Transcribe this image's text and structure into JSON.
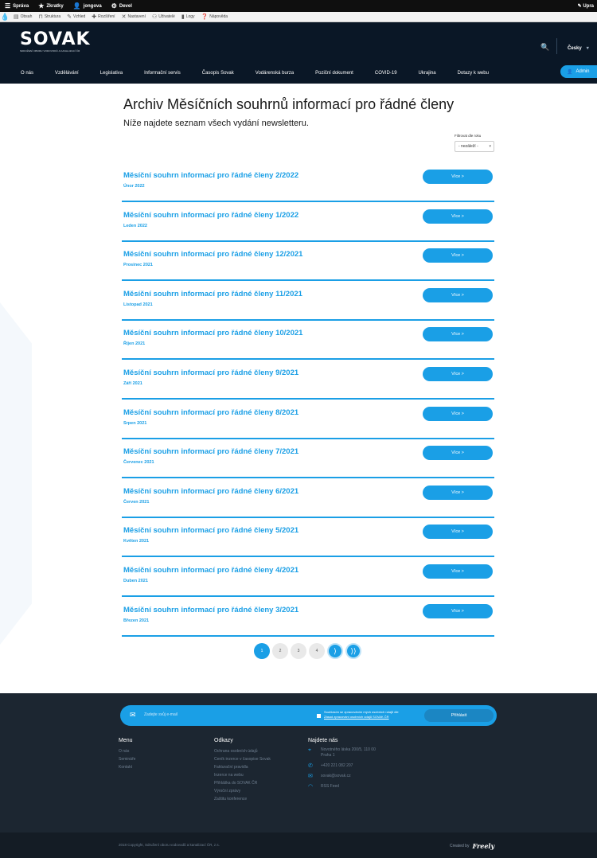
{
  "admin_bar": {
    "items": [
      {
        "icon": "menu-icon",
        "glyph": "☰",
        "label": "Správa"
      },
      {
        "icon": "star-icon",
        "glyph": "★",
        "label": "Zkratky"
      },
      {
        "icon": "user-icon",
        "glyph": "👤",
        "label": "jongova"
      },
      {
        "icon": "gear-icon",
        "glyph": "⚙",
        "label": "Devel"
      }
    ],
    "right_label": "Upra"
  },
  "admin_tray": {
    "items": [
      {
        "icon": "file-icon",
        "glyph": "▤",
        "label": "Obsah"
      },
      {
        "icon": "structure-icon",
        "glyph": "⊓",
        "label": "Struktura"
      },
      {
        "icon": "brush-icon",
        "glyph": "✎",
        "label": "Vzhled"
      },
      {
        "icon": "puzzle-icon",
        "glyph": "✚",
        "label": "Rozšíření"
      },
      {
        "icon": "wrench-icon",
        "glyph": "✕",
        "label": "Nastavení"
      },
      {
        "icon": "people-icon",
        "glyph": "⚇",
        "label": "Uživatelé"
      },
      {
        "icon": "bars-icon",
        "glyph": "▮",
        "label": "Logy"
      },
      {
        "icon": "help-icon",
        "glyph": "❓",
        "label": "Nápověda"
      }
    ]
  },
  "header": {
    "logo_text": "SOVAK",
    "logo_sub": "SDRUŽENÍ OBORU VODOVODŮ A KANALIZACÍ ČR",
    "language": "Česky",
    "nav": [
      "O nás",
      "Vzdělávání",
      "Legislativa",
      "Informační servis",
      "Časopis Sovak",
      "Vodárenská burza",
      "Poziční dokument",
      "COVID-19",
      "Ukrajina",
      "Dotazy k webu"
    ],
    "admin_label": "Admin"
  },
  "main": {
    "title": "Archiv Měsíčních souhrnů informací pro řádné členy",
    "subtitle": "Níže najdete seznam všech vydání newsletteru.",
    "filter_label": "Filtrovat dle roku",
    "filter_value": "- nezáleží -",
    "button_label": "Více >",
    "items": [
      {
        "title": "Měsíční souhrn informací pro řádné členy 2/2022",
        "date": "Únor 2022"
      },
      {
        "title": "Měsíční souhrn informací pro řádné členy 1/2022",
        "date": "Leden 2022"
      },
      {
        "title": "Měsíční souhrn informací pro řádné členy 12/2021",
        "date": "Prosinec 2021"
      },
      {
        "title": "Měsíční souhrn informací pro řádné členy 11/2021",
        "date": "Listopad 2021"
      },
      {
        "title": "Měsíční souhrn informací pro řádné členy 10/2021",
        "date": "Říjen 2021"
      },
      {
        "title": "Měsíční souhrn informací pro řádné členy 9/2021",
        "date": "Září 2021"
      },
      {
        "title": "Měsíční souhrn informací pro řádné členy 8/2021",
        "date": "Srpen 2021"
      },
      {
        "title": "Měsíční souhrn informací pro řádné členy 7/2021",
        "date": "Červenec 2021"
      },
      {
        "title": "Měsíční souhrn informací pro řádné členy 6/2021",
        "date": "Červen 2021"
      },
      {
        "title": "Měsíční souhrn informací pro řádné členy 5/2021",
        "date": "Květen 2021"
      },
      {
        "title": "Měsíční souhrn informací pro řádné členy 4/2021",
        "date": "Duben 2021"
      },
      {
        "title": "Měsíční souhrn informací pro řádné členy 3/2021",
        "date": "Březen 2021"
      }
    ]
  },
  "pager": {
    "pages": [
      "1",
      "2",
      "3",
      "4"
    ],
    "active": "1",
    "next": "⟩",
    "last": "⟩⟩"
  },
  "footer": {
    "newsletter_placeholder": "Zadejte svůj e-mail",
    "consent_line1": "Souhlasím se zpracováním mých osobních údajů dle",
    "consent_link": "Zásad zpracování osobních údajů SOVAK ČR",
    "subscribe_label": "Přihlásit",
    "menu_title": "Menu",
    "menu_items": [
      "O nás",
      "Semináře",
      "Kontakt"
    ],
    "links_title": "Odkazy",
    "links_items": [
      "Ochrana osobních údajů",
      "Ceník inzerce v časopise Sovak",
      "Fakturační pravidla",
      "Inzerce na webu",
      "Přihláška do SOVAK ČR",
      "Výroční zprávy",
      "Zaštitu konference"
    ],
    "find_title": "Najdete nás",
    "address": "Novotného lávka 200/5, 110 00 Praha 1",
    "phone": "+420 221 082 207",
    "email": "sovak@sovak.cz",
    "rss": "RSS Feed",
    "copyright": "2018 Copyright, Sdružení oboru vodovodů a kanalizací ČR, z.s.",
    "created_by": "Created by",
    "creator": "Freely"
  }
}
